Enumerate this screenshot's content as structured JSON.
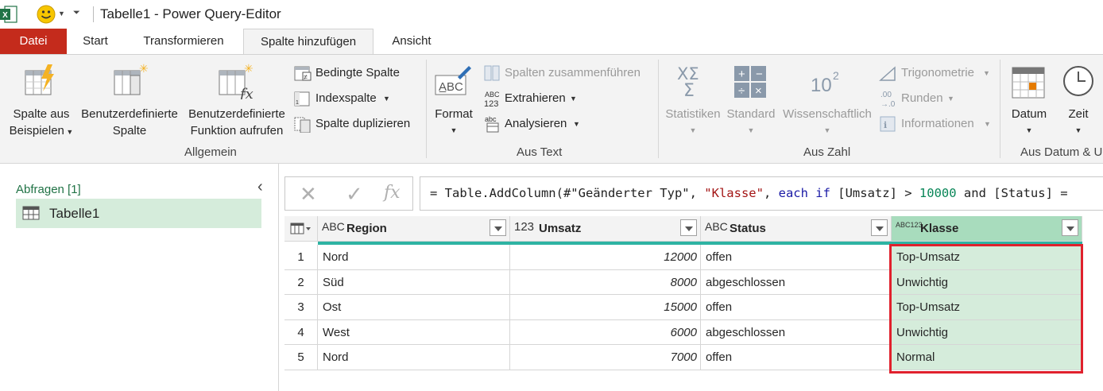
{
  "window": {
    "title": "Tabelle1 - Power Query-Editor",
    "app_icon": "excel-icon",
    "quick_access": "smiley-feedback-icon"
  },
  "tabs": [
    {
      "label": "Datei"
    },
    {
      "label": "Start"
    },
    {
      "label": "Transformieren"
    },
    {
      "label": "Spalte hinzufügen",
      "active": true
    },
    {
      "label": "Ansicht"
    }
  ],
  "ribbon": {
    "allgemein": {
      "label": "Allgemein",
      "beispiel_l1": "Spalte aus",
      "beispiel_l2": "Beispielen",
      "benutzer_l1": "Benutzerdefinierte",
      "benutzer_l2": "Spalte",
      "funktion_l1": "Benutzerdefinierte",
      "funktion_l2": "Funktion aufrufen",
      "bedingte": "Bedingte Spalte",
      "index": "Indexspalte",
      "duplizieren": "Spalte duplizieren"
    },
    "aus_text": {
      "label": "Aus Text",
      "format": "Format",
      "zusammen": "Spalten zusammenführen",
      "extrahieren": "Extrahieren",
      "analysieren": "Analysieren"
    },
    "aus_zahl": {
      "label": "Aus Zahl",
      "statistiken": "Statistiken",
      "standard": "Standard",
      "wissenschaftlich": "Wissenschaftlich",
      "trigonometrie": "Trigonometrie",
      "runden": "Runden",
      "informationen": "Informationen"
    },
    "aus_datum": {
      "label": "Aus Datum & U",
      "datum": "Datum",
      "zeit": "Zeit"
    }
  },
  "queries": {
    "header": "Abfragen [1]",
    "items": [
      {
        "name": "Tabelle1"
      }
    ]
  },
  "formula": {
    "prefix": "= Table.AddColumn(#\"Geänderter Typ\", ",
    "str": "\"Klasse\"",
    "mid1": ", ",
    "kw1": "each if",
    "mid2": " [Umsatz] > ",
    "num": "10000",
    "mid3": " and [Status] ="
  },
  "columns": [
    {
      "name": "Region",
      "type": "ABC"
    },
    {
      "name": "Umsatz",
      "type": "123"
    },
    {
      "name": "Status",
      "type": "ABC"
    },
    {
      "name": "Klasse",
      "type": "ABC123"
    }
  ],
  "rows": [
    {
      "idx": "1",
      "region": "Nord",
      "umsatz": "12000",
      "status": "offen",
      "klasse": "Top-Umsatz"
    },
    {
      "idx": "2",
      "region": "Süd",
      "umsatz": "8000",
      "status": "abgeschlossen",
      "klasse": "Unwichtig"
    },
    {
      "idx": "3",
      "region": "Ost",
      "umsatz": "15000",
      "status": "offen",
      "klasse": "Top-Umsatz"
    },
    {
      "idx": "4",
      "region": "West",
      "umsatz": "6000",
      "status": "abgeschlossen",
      "klasse": "Unwichtig"
    },
    {
      "idx": "5",
      "region": "Nord",
      "umsatz": "7000",
      "status": "offen",
      "klasse": "Normal"
    }
  ],
  "colors": {
    "accent": "#217346",
    "datei": "#c42b1c",
    "highlight": "#e0212d",
    "klasse_fill": "#d5ecdb"
  }
}
